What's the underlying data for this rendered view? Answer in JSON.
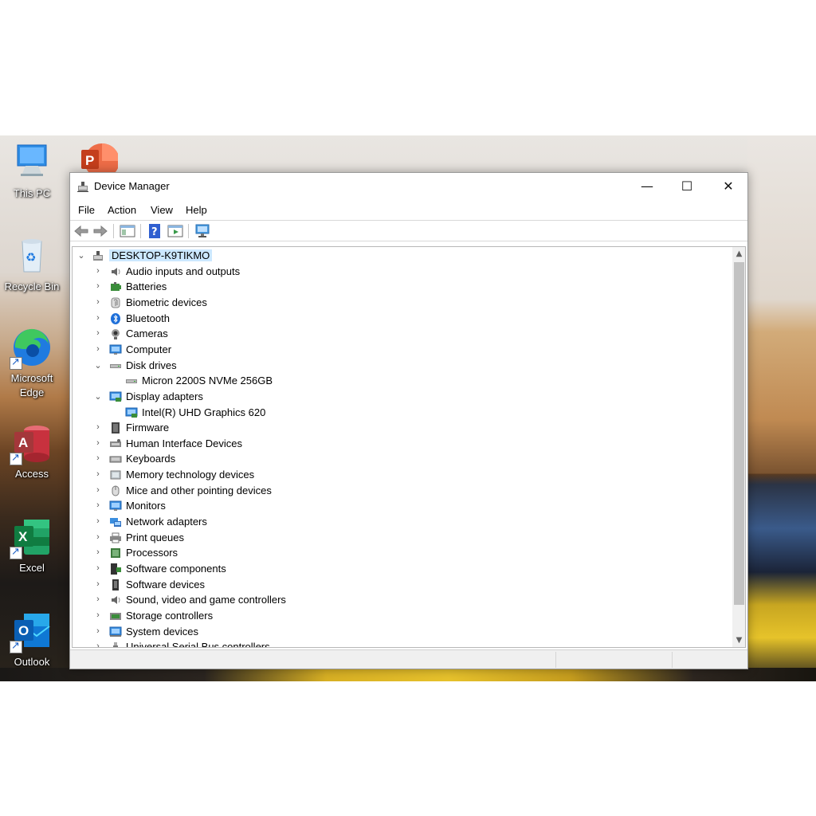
{
  "desktop": {
    "icons": [
      {
        "label": "This PC"
      },
      {
        "label": "Recycle Bin"
      },
      {
        "label": "Microsoft Edge"
      },
      {
        "label": "Access"
      },
      {
        "label": "Excel"
      },
      {
        "label": "Outlook"
      }
    ]
  },
  "window": {
    "title": "Device Manager",
    "controls": {
      "minimize": "—",
      "maximize": "☐",
      "close": "✕"
    },
    "menu": [
      "File",
      "Action",
      "View",
      "Help"
    ],
    "tree": {
      "root": "DESKTOP-K9TIKMO",
      "nodes": [
        {
          "label": "Audio inputs and outputs",
          "icon": "speaker-icon",
          "expanded": false
        },
        {
          "label": "Batteries",
          "icon": "battery-icon",
          "expanded": false
        },
        {
          "label": "Biometric devices",
          "icon": "fingerprint-icon",
          "expanded": false
        },
        {
          "label": "Bluetooth",
          "icon": "bluetooth-icon",
          "expanded": false
        },
        {
          "label": "Cameras",
          "icon": "camera-icon",
          "expanded": false
        },
        {
          "label": "Computer",
          "icon": "monitor-icon",
          "expanded": false
        },
        {
          "label": "Disk drives",
          "icon": "disk-icon",
          "expanded": true
        },
        {
          "label": "Micron 2200S NVMe 256GB",
          "icon": "disk-icon",
          "child": true
        },
        {
          "label": "Display adapters",
          "icon": "display-adapter-icon",
          "expanded": true
        },
        {
          "label": "Intel(R) UHD Graphics 620",
          "icon": "display-adapter-icon",
          "child": true
        },
        {
          "label": "Firmware",
          "icon": "chip-icon",
          "expanded": false
        },
        {
          "label": "Human Interface Devices",
          "icon": "hid-icon",
          "expanded": false
        },
        {
          "label": "Keyboards",
          "icon": "keyboard-icon",
          "expanded": false
        },
        {
          "label": "Memory technology devices",
          "icon": "memory-icon",
          "expanded": false
        },
        {
          "label": "Mice and other pointing devices",
          "icon": "mouse-icon",
          "expanded": false
        },
        {
          "label": "Monitors",
          "icon": "monitor-icon",
          "expanded": false
        },
        {
          "label": "Network adapters",
          "icon": "network-icon",
          "expanded": false
        },
        {
          "label": "Print queues",
          "icon": "printer-icon",
          "expanded": false
        },
        {
          "label": "Processors",
          "icon": "processor-icon",
          "expanded": false
        },
        {
          "label": "Software components",
          "icon": "software-component-icon",
          "expanded": false
        },
        {
          "label": "Software devices",
          "icon": "software-device-icon",
          "expanded": false
        },
        {
          "label": "Sound, video and game controllers",
          "icon": "speaker-icon",
          "expanded": false
        },
        {
          "label": "Storage controllers",
          "icon": "storage-controller-icon",
          "expanded": false
        },
        {
          "label": "System devices",
          "icon": "system-devices-icon",
          "expanded": false
        },
        {
          "label": "Universal Serial Bus controllers",
          "icon": "usb-icon",
          "expanded": false
        }
      ]
    }
  }
}
